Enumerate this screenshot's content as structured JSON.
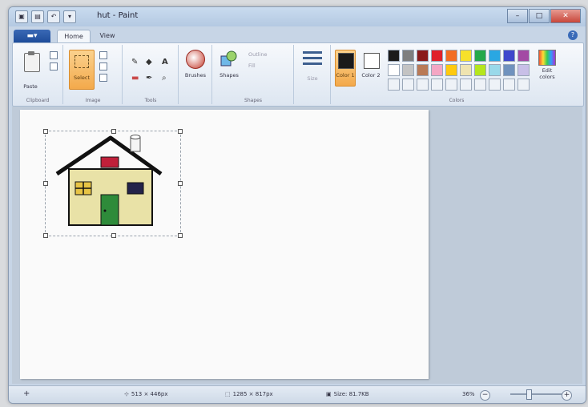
{
  "window": {
    "title": "hut - Paint"
  },
  "quick_access": {
    "undo_symbol": "↶",
    "dropdown_symbol": "▾"
  },
  "ribbon_tabs": {
    "file_label": "",
    "home_label": "Home",
    "view_label": "View"
  },
  "clipboard": {
    "paste_label": "Paste",
    "group_label": "Clipboard"
  },
  "image": {
    "select_label": "Select",
    "group_label": "Image"
  },
  "tools": {
    "pencil": "✎",
    "fill": "◆",
    "text": "A",
    "eraser": "▬",
    "picker": "✒",
    "magnifier": "⌕",
    "group_label": "Tools"
  },
  "brushes": {
    "label": "Brushes"
  },
  "shapes": {
    "label": "Shapes",
    "outline_label": "Outline",
    "fill_label": "Fill",
    "group_label": "Shapes"
  },
  "size": {
    "label": "Size"
  },
  "colors": {
    "color1_label": "Color 1",
    "color2_label": "Color 2",
    "edit_colors_label": "Edit colors",
    "group_label": "Colors",
    "color1_value": "#1a1a1a",
    "color2_value": "#ffffff",
    "palette_row1": [
      "#1b1b1b",
      "#7f7f7f",
      "#8a1a1a",
      "#e0202a",
      "#f26c22",
      "#f7e12a",
      "#25a84b",
      "#2aa7e2",
      "#3f47cc",
      "#a349a4"
    ],
    "palette_row2": [
      "#ffffff",
      "#c3c3c3",
      "#b97a57",
      "#f4a6c4",
      "#ffc90e",
      "#efe4b0",
      "#b5e61d",
      "#99d9ea",
      "#7092be",
      "#c8bfe7"
    ],
    "palette_row3": [
      "#eef2f7",
      "#eef2f7",
      "#eef2f7",
      "#eef2f7",
      "#eef2f7",
      "#eef2f7",
      "#eef2f7",
      "#eef2f7",
      "#eef2f7",
      "#eef2f7"
    ]
  },
  "house": {
    "wall_color": "#e9e2a7",
    "roof_color": "#111111",
    "door_color": "#2e8b3a",
    "roof_window_color": "#c0203a",
    "right_window_color": "#23234a",
    "left_window_color": "#e7c445"
  },
  "status": {
    "cursor_pos": "513 × 446px",
    "selection_size": "1285 × 817px",
    "file_size": "Size: 81.7KB",
    "zoom": "36%"
  }
}
